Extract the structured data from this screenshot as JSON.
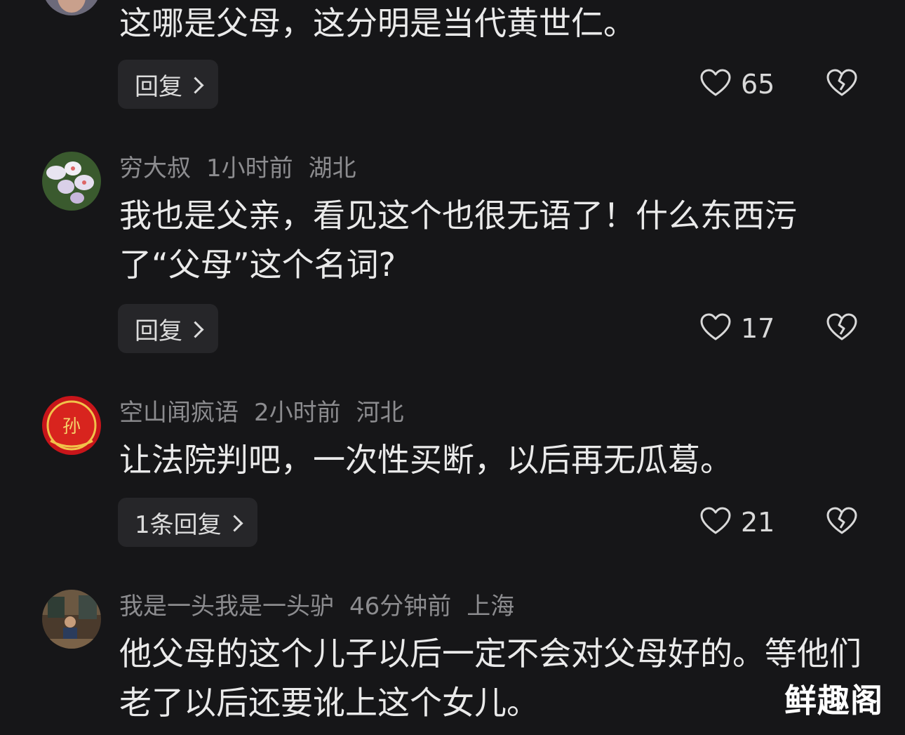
{
  "comments": [
    {
      "user": "",
      "time": "",
      "location": "",
      "text": "这哪是父母，这分明是当代黄世仁。",
      "reply_label": "回复",
      "likes": "65"
    },
    {
      "user": "穷大叔",
      "time": "1小时前",
      "location": "湖北",
      "text": "我也是父亲，看见这个也很无语了！什么东西污了“父母”这个名词?",
      "reply_label": "回复",
      "likes": "17"
    },
    {
      "user": "空山闻疯语",
      "time": "2小时前",
      "location": "河北",
      "text": "让法院判吧，一次性买断，以后再无瓜葛。",
      "reply_label": "1条回复",
      "likes": "21"
    },
    {
      "user": "我是一头我是一头驴",
      "time": "46分钟前",
      "location": "上海",
      "text": "他父母的这个儿子以后一定不会对父母好的。等他们老了以后还要讹上这个女儿。"
    }
  ],
  "watermark": "鲜趣阁",
  "colors": {
    "background": "#161618",
    "meta_text": "#8c8c8f",
    "content_text": "#eaeaea",
    "button_bg": "#262629"
  },
  "icons": {
    "like": "heart-icon",
    "dislike": "broken-heart-icon"
  }
}
